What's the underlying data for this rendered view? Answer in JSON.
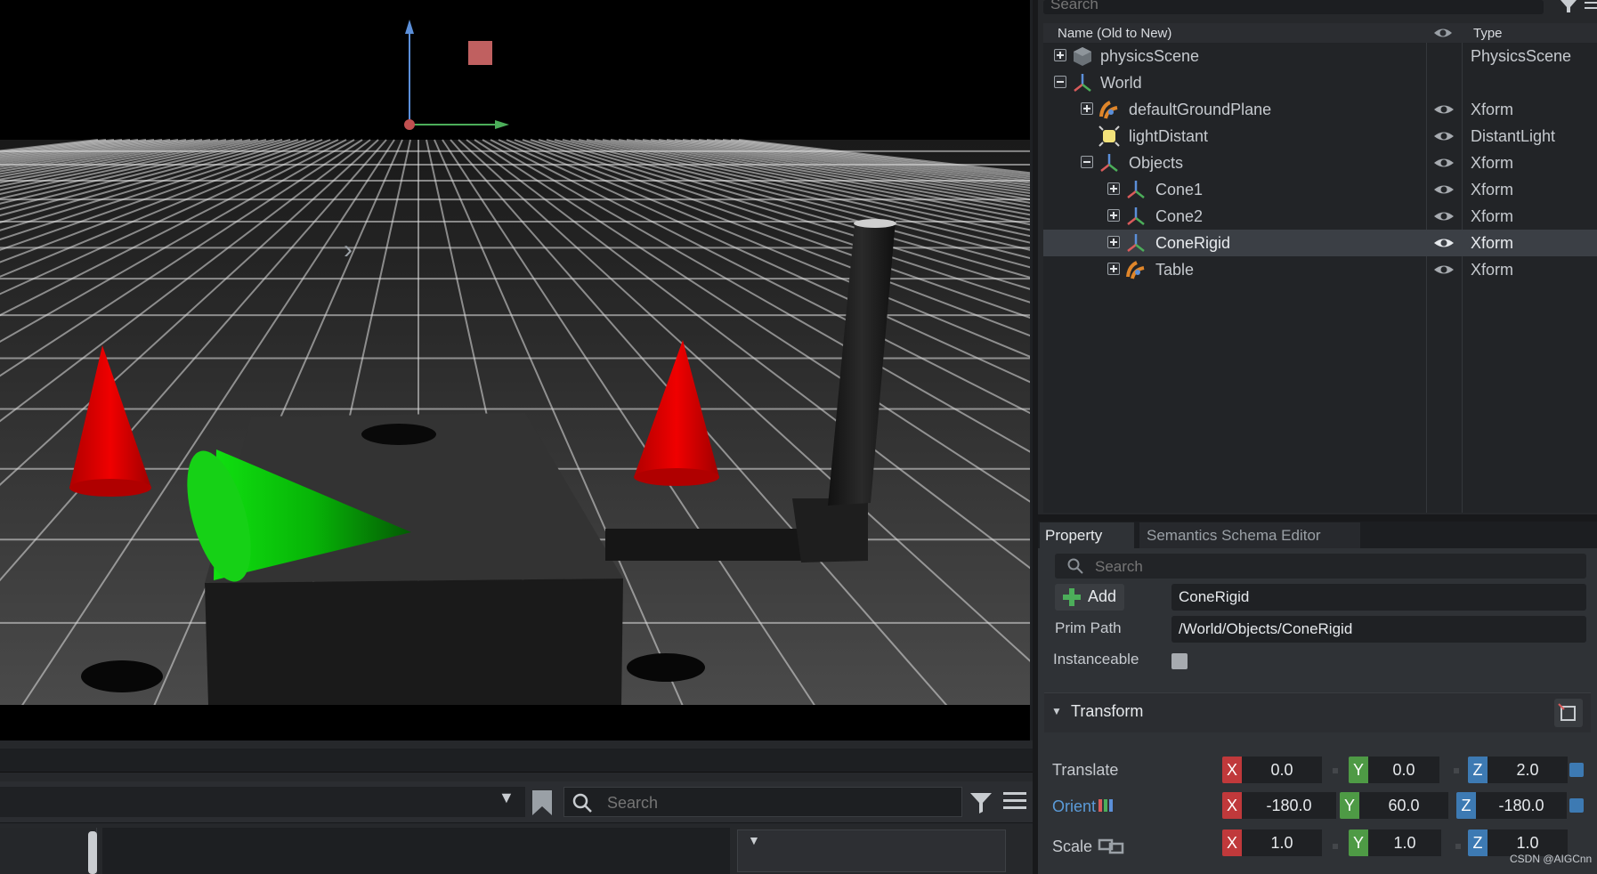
{
  "stage": {
    "search_placeholder": "Search",
    "columns": {
      "name": "Name (Old to New)",
      "type": "Type"
    },
    "rows": [
      {
        "label": "physicsScene",
        "type": "PhysicsScene"
      },
      {
        "label": "World",
        "type": ""
      },
      {
        "label": "defaultGroundPlane",
        "type": "Xform"
      },
      {
        "label": "lightDistant",
        "type": "DistantLight"
      },
      {
        "label": "Objects",
        "type": "Xform"
      },
      {
        "label": "Cone1",
        "type": "Xform"
      },
      {
        "label": "Cone2",
        "type": "Xform"
      },
      {
        "label": "ConeRigid",
        "type": "Xform"
      },
      {
        "label": "Table",
        "type": "Xform"
      }
    ],
    "selected_row": "ConeRigid"
  },
  "property": {
    "tabs": [
      "Property",
      "Semantics Schema Editor"
    ],
    "search_placeholder": "Search",
    "add_label": "Add",
    "prim_name": "ConeRigid",
    "prim_path_label": "Prim Path",
    "prim_path": "/World/Objects/ConeRigid",
    "instanceable_label": "Instanceable",
    "transform": {
      "title": "Transform",
      "translate": {
        "label": "Translate",
        "x": "0.0",
        "y": "0.0",
        "z": "2.0"
      },
      "orient": {
        "label": "Orient",
        "x": "-180.0",
        "y": "60.0",
        "z": "-180.0"
      },
      "scale": {
        "label": "Scale",
        "x": "1.0",
        "y": "1.0",
        "z": "1.0"
      },
      "axes": [
        "X",
        "Y",
        "Z"
      ]
    }
  },
  "console": {
    "search_placeholder": "Search"
  },
  "watermark": "CSDN @AIGCnn",
  "colors": {
    "cone_red": "#e00000",
    "cone_green": "#00cc00",
    "axis_x": "#c0393b",
    "axis_y": "#4e9a45",
    "axis_z": "#3d7ab3",
    "selection": "#3b3f45"
  },
  "icons": [
    "cube-icon",
    "xform-icon",
    "ground-plane-icon",
    "light-icon",
    "eye-icon",
    "search-icon",
    "filter-icon",
    "menu-icon",
    "bookmark-icon",
    "plus-icon",
    "chevron-right-icon"
  ]
}
